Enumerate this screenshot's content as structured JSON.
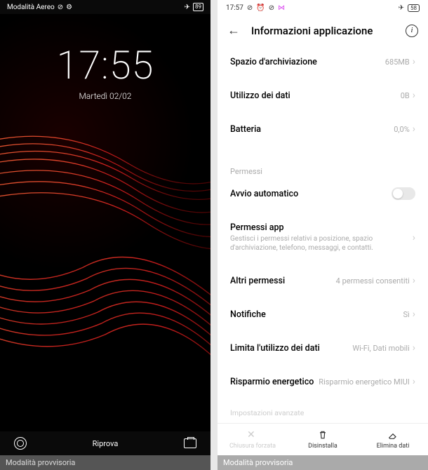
{
  "left": {
    "status": {
      "airplane_label": "Modalità Aereo",
      "battery": "89"
    },
    "clock": {
      "time": "17:55",
      "date": "Martedì 02/02"
    },
    "bottom": {
      "retry": "Riprova"
    },
    "safe_mode": "Modalità provvisoria"
  },
  "right": {
    "status": {
      "time": "17:57",
      "battery": "58"
    },
    "header": {
      "title": "Informazioni applicazione"
    },
    "rows": {
      "storage_label": "Spazio d'archiviazione",
      "storage_value": "685MB",
      "data_label": "Utilizzo dei dati",
      "data_value": "0B",
      "battery_label": "Batteria",
      "battery_value": "0,0%",
      "perm_section": "Permessi",
      "autostart_label": "Avvio automatico",
      "appperm_label": "Permessi app",
      "appperm_desc": "Gestisci i permessi relativi a posizione, spazio d'archiviazione, telefono, messaggi, e contatti.",
      "otherperm_label": "Altri permessi",
      "otherperm_value": "4 permessi consentiti",
      "notif_label": "Notifiche",
      "notif_value": "Sì",
      "datalimit_label": "Limita l'utilizzo dei dati",
      "datalimit_value": "Wi-Fi, Dati mobili",
      "powersave_label": "Risparmio energetico",
      "powersave_value": "Risparmio energetico MIUI",
      "advanced_label": "Impostazioni avanzate"
    },
    "bottom": {
      "forcestop": "Chiusura forzata",
      "uninstall": "Disinstalla",
      "cleardata": "Elimina dati"
    },
    "safe_mode": "Modalità provvisoria"
  }
}
